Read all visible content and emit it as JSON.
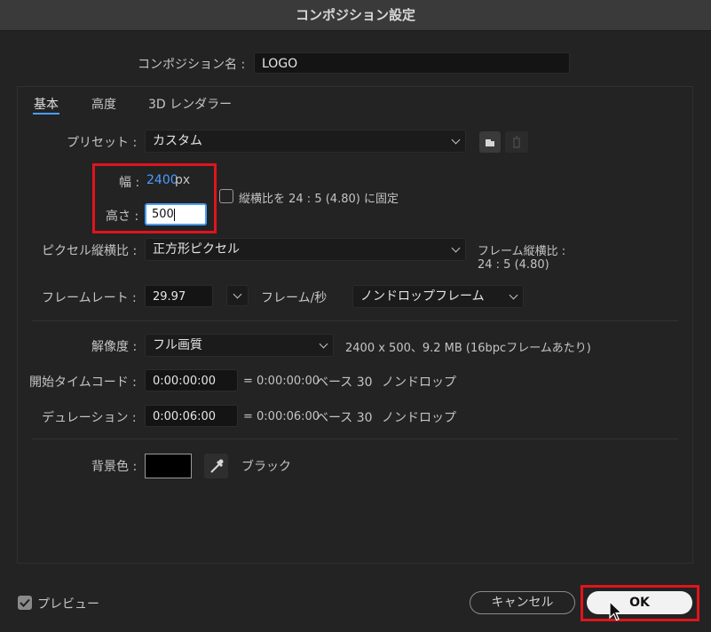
{
  "window": {
    "title": "コンポジション設定"
  },
  "composition_name": {
    "label": "コンポジション名 :",
    "value": "LOGO"
  },
  "tabs": [
    {
      "label": "基本",
      "active": true
    },
    {
      "label": "高度",
      "active": false
    },
    {
      "label": "3D レンダラー",
      "active": false
    }
  ],
  "preset": {
    "label": "プリセット :",
    "value": "カスタム"
  },
  "size": {
    "width_label": "幅 :",
    "width_value": "2400",
    "width_unit": "px",
    "height_label": "高さ :",
    "height_value": "500",
    "lock_aspect_label": "縦横比を 24 : 5 (4.80) に固定",
    "lock_aspect_checked": false
  },
  "pixel_aspect": {
    "label": "ピクセル縦横比 :",
    "value": "正方形ピクセル",
    "frame_aspect_label": "フレーム縦横比 :",
    "frame_aspect_value": "24 : 5 (4.80)"
  },
  "frame_rate": {
    "label": "フレームレート :",
    "value": "29.97",
    "unit": "フレーム/秒",
    "drop_frame": "ノンドロップフレーム"
  },
  "resolution": {
    "label": "解像度 :",
    "value": "フル画質",
    "info": "2400 x 500、9.2 MB (16bpcフレームあたり)"
  },
  "start_timecode": {
    "label": "開始タイムコード :",
    "value": "0:00:00:00",
    "equals": "= 0:00:00:00",
    "base": "ベース 30",
    "mode": "ノンドロップ"
  },
  "duration": {
    "label": "デュレーション :",
    "value": "0:00:06:00",
    "equals": "= 0:00:06:00",
    "base": "ベース 30",
    "mode": "ノンドロップ"
  },
  "background": {
    "label": "背景色 :",
    "color": "#000000",
    "name": "ブラック"
  },
  "footer": {
    "preview_label": "プレビュー",
    "preview_checked": true,
    "cancel_label": "キャンセル",
    "ok_label": "OK"
  },
  "colors": {
    "accent": "#4a9eff",
    "highlight": "#e0141d"
  }
}
